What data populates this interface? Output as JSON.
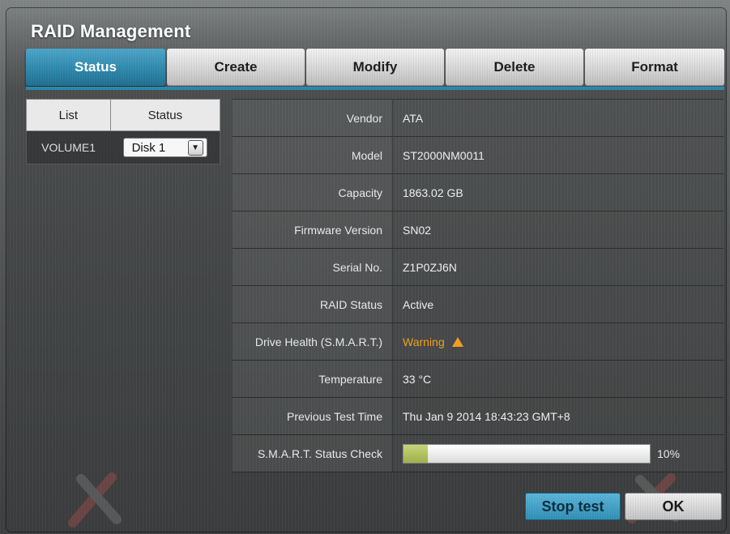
{
  "window": {
    "title": "RAID Management"
  },
  "tabs": [
    {
      "label": "Status",
      "active": true
    },
    {
      "label": "Create",
      "active": false
    },
    {
      "label": "Modify",
      "active": false
    },
    {
      "label": "Delete",
      "active": false
    },
    {
      "label": "Format",
      "active": false
    }
  ],
  "list": {
    "headers": [
      "List",
      "Status"
    ],
    "rows": [
      {
        "name": "VOLUME1",
        "disk_select": "Disk 1"
      }
    ]
  },
  "details": {
    "vendor": {
      "label": "Vendor",
      "value": "ATA"
    },
    "model": {
      "label": "Model",
      "value": "ST2000NM0011"
    },
    "capacity": {
      "label": "Capacity",
      "value": "1863.02 GB"
    },
    "firmware": {
      "label": "Firmware Version",
      "value": "SN02"
    },
    "serial": {
      "label": "Serial No.",
      "value": "Z1P0ZJ6N"
    },
    "raid_status": {
      "label": "RAID Status",
      "value": "Active"
    },
    "drive_health": {
      "label": "Drive Health (S.M.A.R.T.)",
      "value": "Warning",
      "color": "#f0a020",
      "icon": "warning-triangle-icon"
    },
    "temperature": {
      "label": "Temperature",
      "value": "33 °C"
    },
    "previous_test": {
      "label": "Previous Test Time",
      "value": "Thu Jan 9 2014 18:43:23 GMT+8"
    },
    "smart_check": {
      "label": "S.M.A.R.T. Status Check",
      "progress": 0.1,
      "percent_text": "10%"
    }
  },
  "buttons": {
    "stop_test": "Stop test",
    "ok": "OK"
  },
  "colors": {
    "accent": "#2d86ab",
    "warning": "#f0a020"
  }
}
